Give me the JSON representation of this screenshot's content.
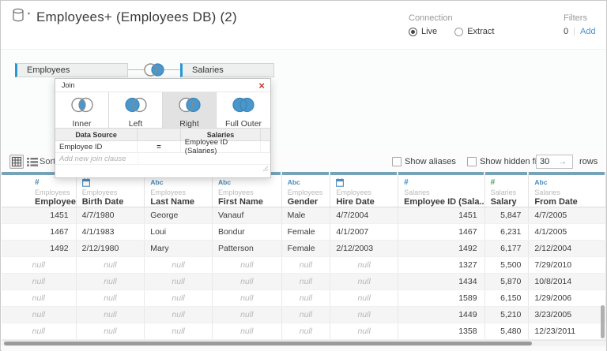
{
  "window": {
    "title": "Employees+ (Employees DB) (2)"
  },
  "connection": {
    "label": "Connection",
    "options": [
      {
        "label": "Live",
        "selected": true
      },
      {
        "label": "Extract",
        "selected": false
      }
    ]
  },
  "filters": {
    "label": "Filters",
    "count": "0",
    "add_label": "Add"
  },
  "canvas": {
    "tables": [
      {
        "name": "Employees"
      },
      {
        "name": "Salaries"
      }
    ],
    "join_type": "right"
  },
  "join_dialog": {
    "title": "Join",
    "close_glyph": "×",
    "types": [
      {
        "label": "Inner",
        "type": "inner",
        "selected": false
      },
      {
        "label": "Left",
        "type": "left",
        "selected": false
      },
      {
        "label": "Right",
        "type": "right",
        "selected": true
      },
      {
        "label": "Full Outer",
        "type": "full",
        "selected": false
      }
    ],
    "clause_headers": {
      "left": "Data Source",
      "right": "Salaries"
    },
    "clauses": [
      {
        "left": "Employee ID",
        "op": "=",
        "right": "Employee ID (Salaries)"
      }
    ],
    "add_clause_placeholder": "Add new join clause"
  },
  "toolbar": {
    "sort_label": "Sort fields",
    "show_aliases_label": "Show aliases",
    "show_hidden_label": "Show hidden fields",
    "rows_value": "30",
    "rows_label": "rows",
    "rows_arrow": "→"
  },
  "grid": {
    "columns": [
      {
        "icon": "#",
        "table": "Employees",
        "field": "Employee ID",
        "align": "right"
      },
      {
        "icon": "calendar",
        "table": "Employees",
        "field": "Birth Date",
        "align": "left"
      },
      {
        "icon": "Abc",
        "table": "Employees",
        "field": "Last Name",
        "align": "left"
      },
      {
        "icon": "Abc",
        "table": "Employees",
        "field": "First Name",
        "align": "left"
      },
      {
        "icon": "Abc",
        "table": "Employees",
        "field": "Gender",
        "align": "left"
      },
      {
        "icon": "calendar",
        "table": "Employees",
        "field": "Hire Date",
        "align": "left"
      },
      {
        "icon": "#",
        "table": "Salaries",
        "field": "Employee ID (Sala...",
        "align": "right"
      },
      {
        "icon": "#",
        "icon_color": "green",
        "table": "Salaries",
        "field": "Salary",
        "align": "right"
      },
      {
        "icon": "Abc",
        "table": "Salaries",
        "field": "From Date",
        "align": "left"
      }
    ],
    "rows": [
      [
        "1451",
        "4/7/1980",
        "George",
        "Vanauf",
        "Male",
        "4/7/2004",
        "1451",
        "5,847",
        "4/7/2005"
      ],
      [
        "1467",
        "4/1/1983",
        "Loui",
        "Bondur",
        "Female",
        "4/1/2007",
        "1467",
        "6,231",
        "4/1/2005"
      ],
      [
        "1492",
        "2/12/1980",
        "Mary",
        "Patterson",
        "Female",
        "2/12/2003",
        "1492",
        "6,177",
        "2/12/2004"
      ],
      [
        "null",
        "null",
        "null",
        "null",
        "null",
        "null",
        "1327",
        "5,500",
        "7/29/2010"
      ],
      [
        "null",
        "null",
        "null",
        "null",
        "null",
        "null",
        "1434",
        "5,870",
        "10/8/2014"
      ],
      [
        "null",
        "null",
        "null",
        "null",
        "null",
        "null",
        "1589",
        "6,150",
        "1/29/2006"
      ],
      [
        "null",
        "null",
        "null",
        "null",
        "null",
        "null",
        "1449",
        "5,210",
        "3/23/2005"
      ],
      [
        "null",
        "null",
        "null",
        "null",
        "null",
        "null",
        "1358",
        "5,480",
        "12/23/2011"
      ]
    ]
  },
  "colors": {
    "venn_blue": "#4a97cb",
    "table_accent_bar": "#2a97d3",
    "column_strip": "#76a3ba",
    "add_link": "#4a90d0",
    "close_red": "#c0392b",
    "number_icon_blue": "#4a8cbe",
    "number_icon_green": "#55a065"
  }
}
